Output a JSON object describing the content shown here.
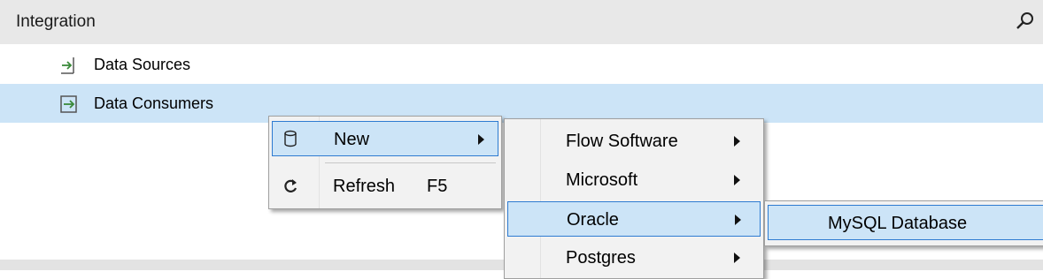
{
  "header": {
    "title": "Integration",
    "search_icon": "search-icon"
  },
  "tree": [
    {
      "label": "Data Sources",
      "icon": "data-source-icon",
      "selected": false
    },
    {
      "label": "Data Consumers",
      "icon": "data-consumer-icon",
      "selected": true
    }
  ],
  "context_menu": {
    "items": [
      {
        "label": "New",
        "icon": "database-icon",
        "has_submenu": true
      },
      {
        "label": "Refresh",
        "shortcut": "F5",
        "icon": "refresh-icon"
      }
    ]
  },
  "submenu_new": {
    "items": [
      {
        "label": "Flow Software"
      },
      {
        "label": "Microsoft"
      },
      {
        "label": "Oracle"
      },
      {
        "label": "Postgres"
      }
    ]
  },
  "submenu_oracle": {
    "items": [
      {
        "label": "MySQL Database"
      }
    ]
  },
  "colors": {
    "selection": "#cce4f7",
    "highlight_border": "#2e7bd1",
    "menu_bg": "#f2f2f2",
    "header_bg": "#e8e8e8"
  }
}
